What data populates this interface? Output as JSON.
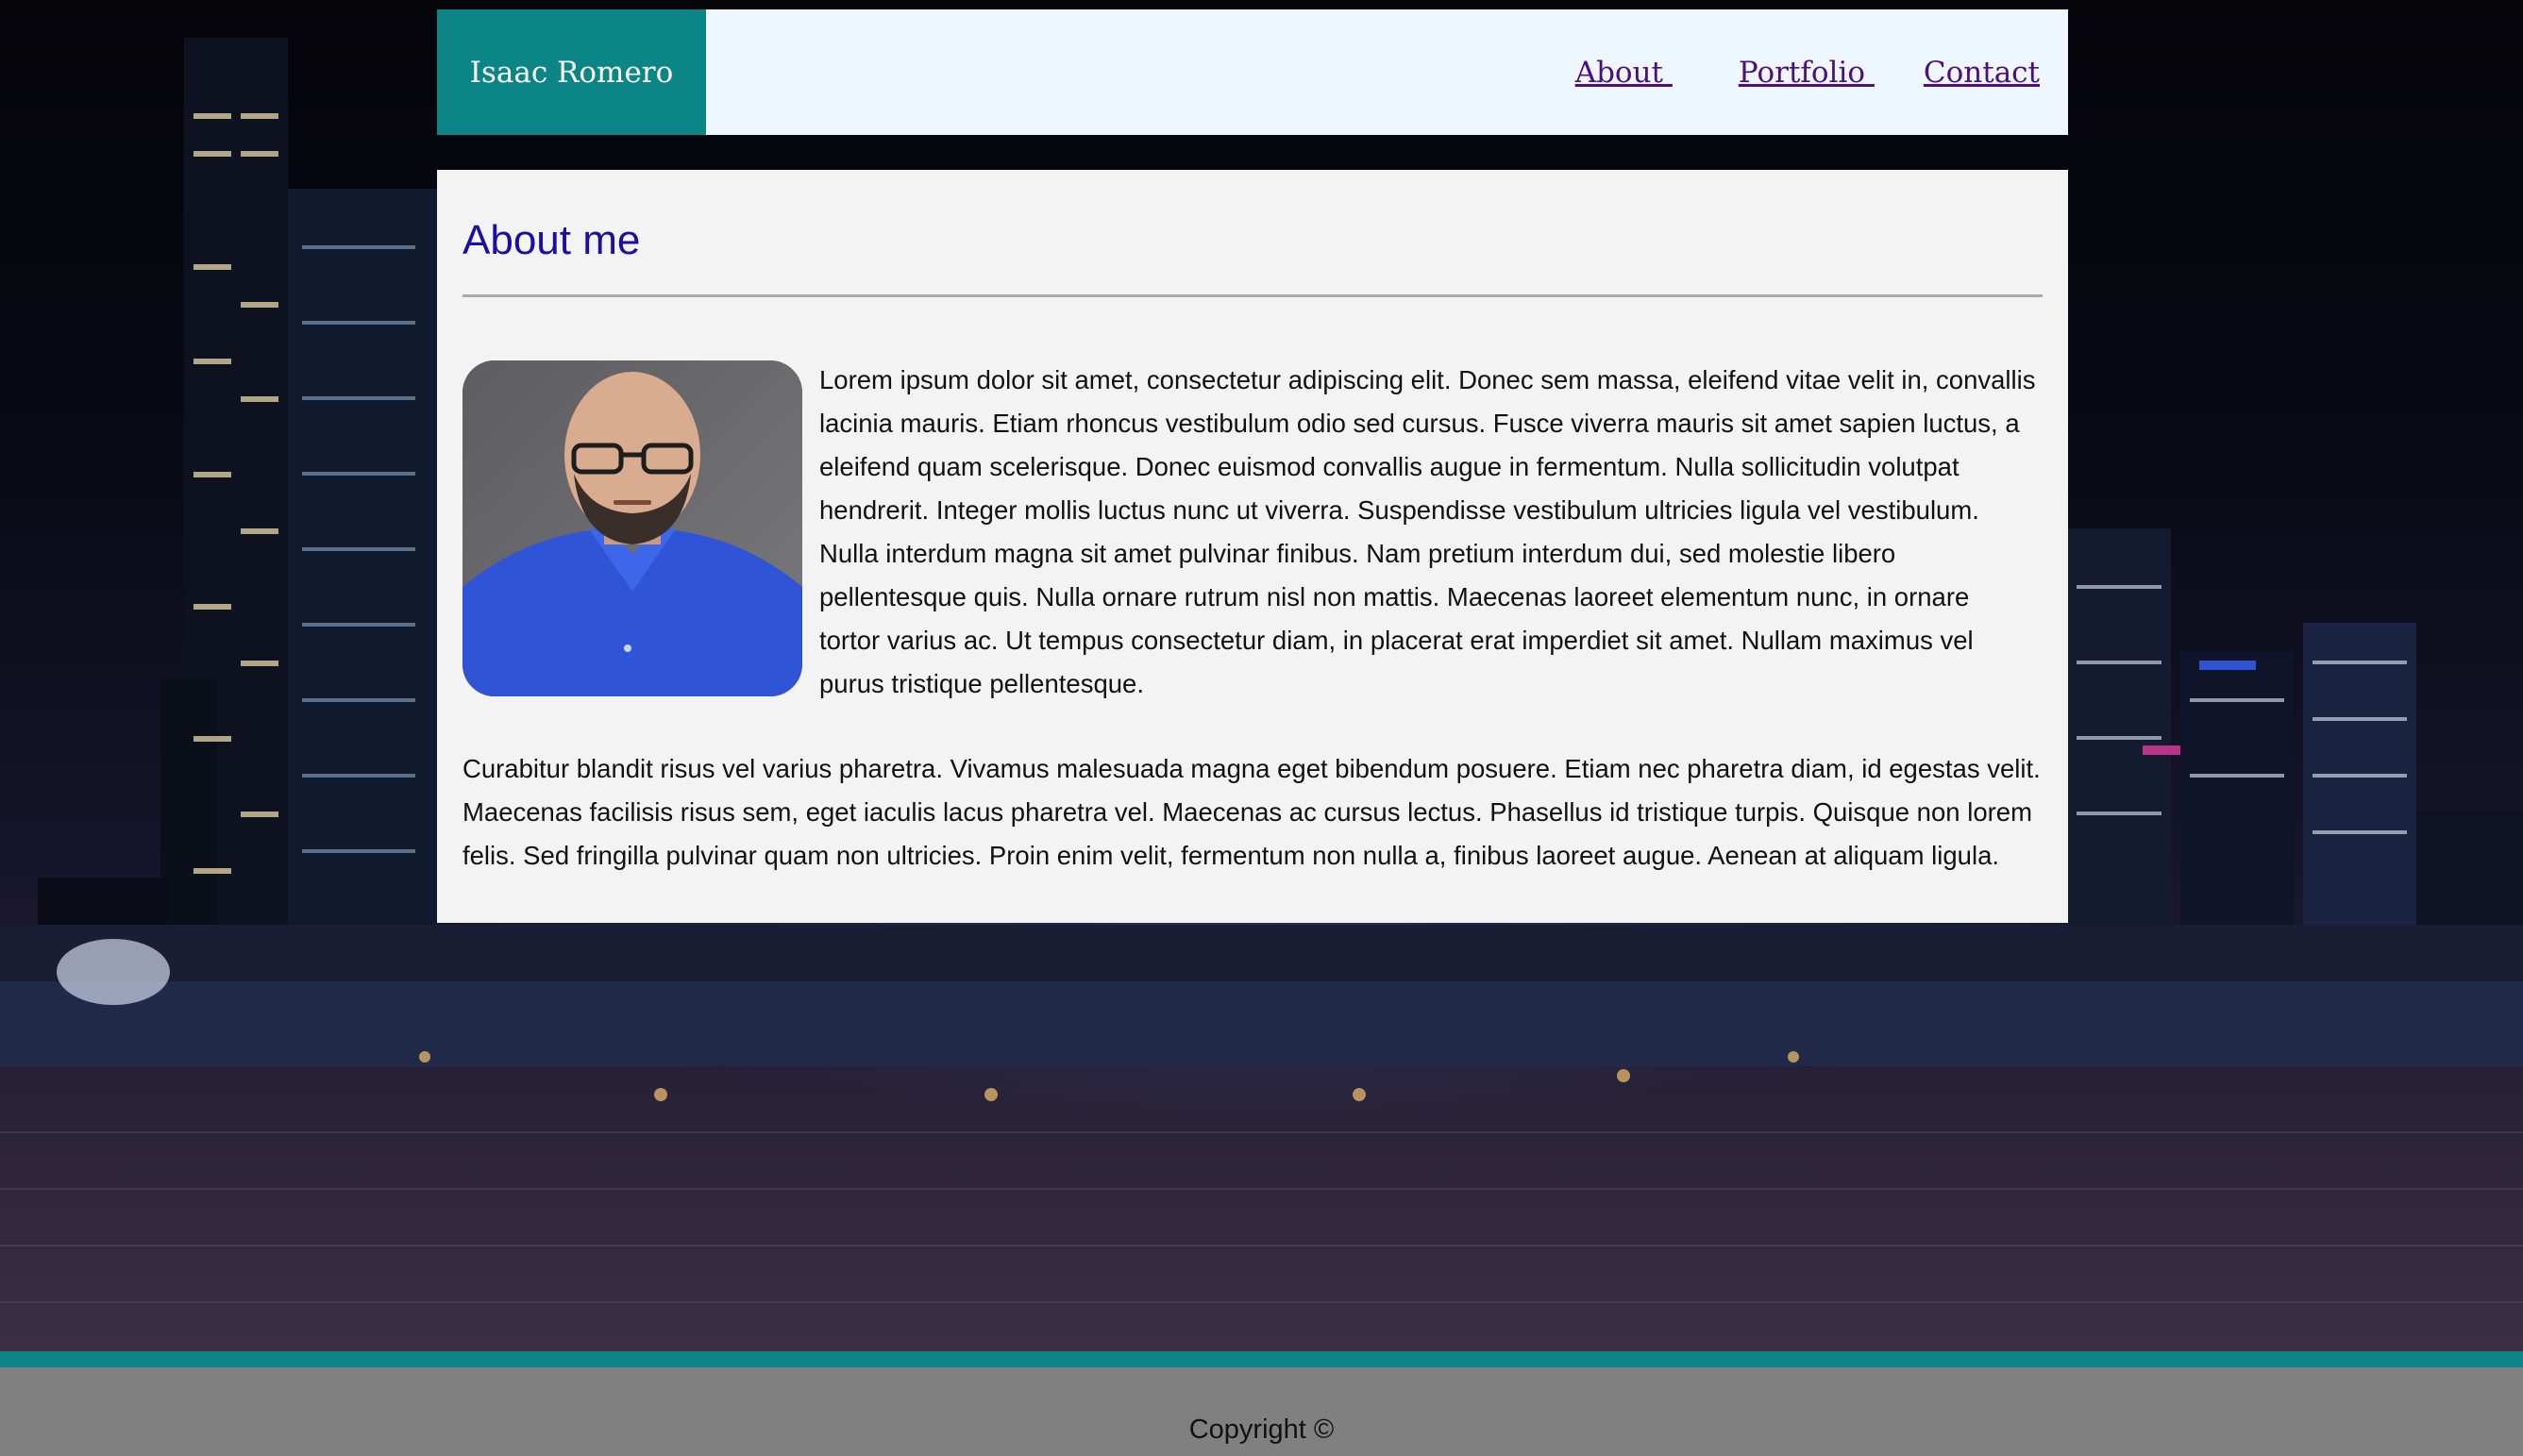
{
  "header": {
    "brand": "Isaac Romero",
    "nav": {
      "about": "About ",
      "portfolio": "Portfolio ",
      "contact": "Contact"
    }
  },
  "main": {
    "title": "About me",
    "paragraph_1": "Lorem ipsum dolor sit amet, consectetur adipiscing elit. Donec sem massa, eleifend vitae velit in, convallis lacinia mauris. Etiam rhoncus vestibulum odio sed cursus. Fusce viverra mauris sit amet sapien luctus, a eleifend quam scelerisque. Donec euismod convallis augue in fermentum. Nulla sollicitudin volutpat hendrerit. Integer mollis luctus nunc ut viverra. Suspendisse vestibulum ultricies ligula vel vestibulum. Nulla interdum magna sit amet pulvinar finibus. Nam pretium interdum dui, sed molestie libero pellentesque quis. Nulla ornare rutrum nisl non mattis. Maecenas laoreet elementum nunc, in ornare tortor varius ac. Ut tempus consectetur diam, in placerat erat imperdiet sit amet. Nullam maximus vel purus tristique pellentesque.",
    "paragraph_2": "Curabitur blandit risus vel varius pharetra. Vivamus malesuada magna eget bibendum posuere. Etiam nec pharetra diam, id egestas velit. Maecenas facilisis risus sem, eget iaculis lacus pharetra vel. Maecenas ac cursus lectus. Phasellus id tristique turpis. Quisque non lorem felis. Sed fringilla pulvinar quam non ultricies. Proin enim velit, fermentum non nulla a, finibus laoreet augue. Aenean at aliquam ligula."
  },
  "footer": {
    "copyright": "Copyright ©"
  },
  "colors": {
    "brand_bg": "#0b8585",
    "header_bg": "#eef6ff",
    "nav_link": "#4b0f80",
    "title": "#1b0fa3",
    "card_bg": "#f3f3f3",
    "footer_bg": "#808080"
  }
}
